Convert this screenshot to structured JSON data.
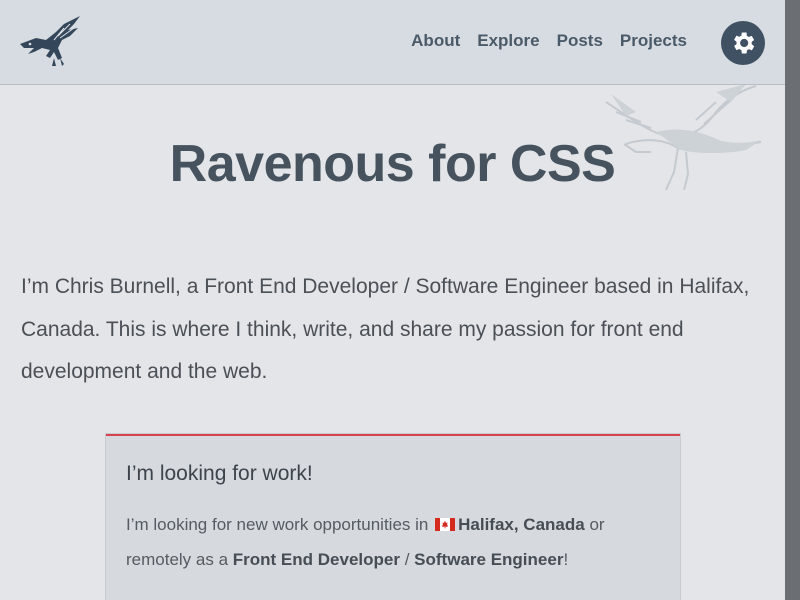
{
  "header": {
    "nav": [
      "About",
      "Explore",
      "Posts",
      "Projects"
    ]
  },
  "hero": {
    "title": "Ravenous for CSS"
  },
  "intro": {
    "text": "I’m Chris Burnell, a Front End Developer / Software Engineer based in Halifax, Canada. This is where I think, write, and share my passion for front end development and the web."
  },
  "callout": {
    "title": "I’m looking for work!",
    "line_prefix": "I’m looking for new work opportunities in",
    "location": "Halifax, Canada",
    "line_middle": "or remotely as a",
    "role_1": "Front End Developer",
    "separator": "/",
    "role_2": "Software Engineer",
    "line_suffix": "!",
    "accent_color": "#d7424e"
  },
  "icons": {
    "logo": "raven-logo",
    "settings": "gear-icon",
    "flag": "canada-flag-icon"
  }
}
